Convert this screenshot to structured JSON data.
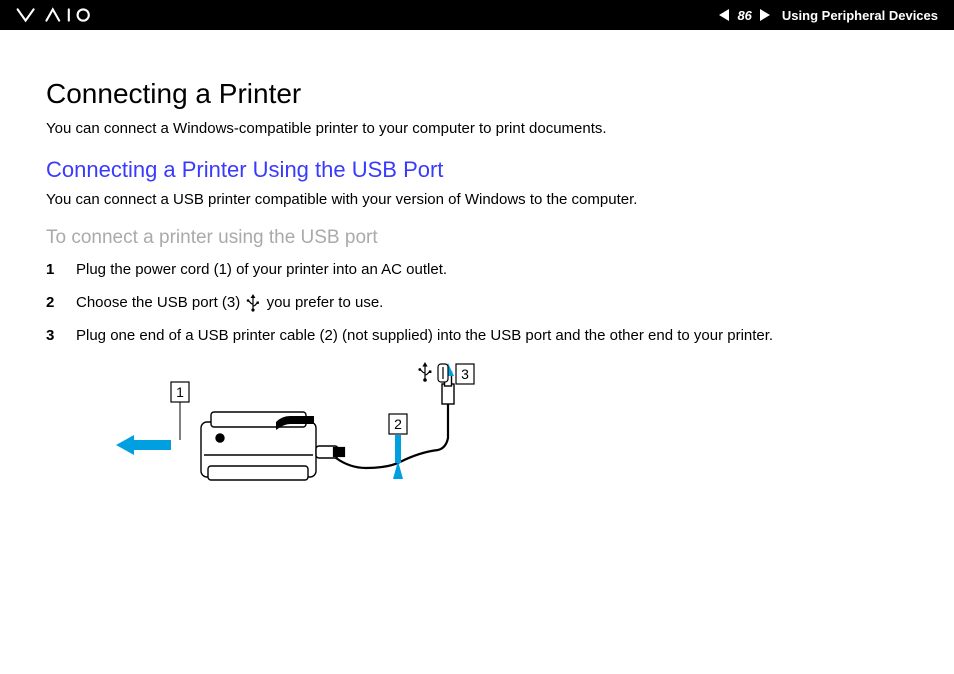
{
  "header": {
    "page_number": "86",
    "section": "Using Peripheral Devices"
  },
  "main": {
    "heading1": "Connecting a Printer",
    "intro": "You can connect a Windows-compatible printer to your computer to print documents.",
    "heading2": "Connecting a Printer Using the USB Port",
    "sub_intro": "You can connect a USB printer compatible with your version of Windows to the computer.",
    "heading3": "To connect a printer using the USB port",
    "steps": [
      {
        "num": "1",
        "text": "Plug the power cord (1) of your printer into an AC outlet."
      },
      {
        "num": "2",
        "text_a": "Choose the USB port (3) ",
        "text_b": " you prefer to use."
      },
      {
        "num": "3",
        "text": "Plug one end of a USB printer cable (2) (not supplied) into the USB port and the other end to your printer."
      }
    ],
    "diagram_labels": {
      "l1": "1",
      "l2": "2",
      "l3": "3"
    }
  }
}
